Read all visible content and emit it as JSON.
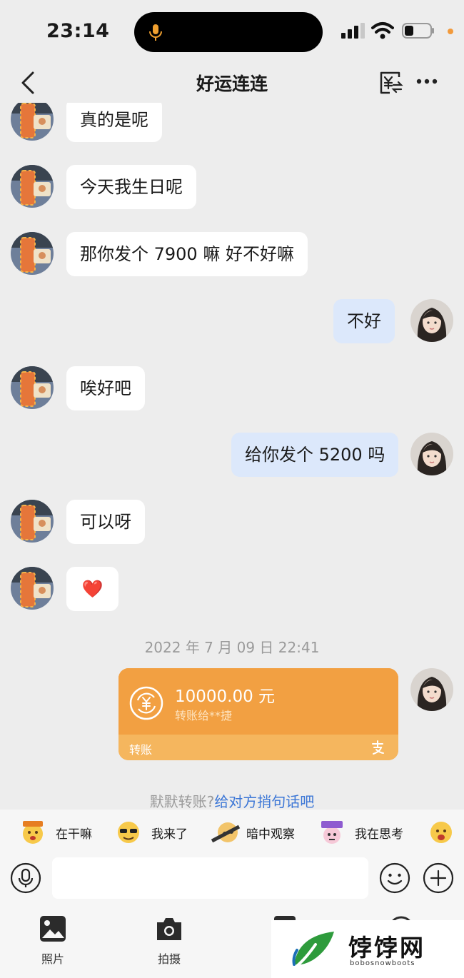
{
  "status_bar": {
    "time": "23:14"
  },
  "nav": {
    "title": "好运连连"
  },
  "messages": [
    {
      "side": "left",
      "text": "真的是呢"
    },
    {
      "side": "left",
      "text": "今天我生日呢"
    },
    {
      "side": "left",
      "text": "那你发个 7900 嘛 好不好嘛"
    },
    {
      "side": "right",
      "text": "不好"
    },
    {
      "side": "left",
      "text": "唉好吧"
    },
    {
      "side": "right",
      "text": "给你发个 5200 吗"
    },
    {
      "side": "left",
      "text": "可以呀"
    },
    {
      "side": "left",
      "text": "❤️"
    }
  ],
  "timestamp": "2022 年 7 月 09 日 22:41",
  "transfer": {
    "amount": "10000.00 元",
    "recipient": "转账给**捷",
    "label": "转账",
    "icon": "yuan-transfer-icon"
  },
  "hint": {
    "prefix": "默默转账?",
    "link": "给对方捎句话吧"
  },
  "stickers": [
    {
      "label": "在干嘛",
      "icon": "sticker-what-doing"
    },
    {
      "label": "我来了",
      "icon": "sticker-sunglasses"
    },
    {
      "label": "暗中观察",
      "icon": "sticker-observe"
    },
    {
      "label": "我在思考",
      "icon": "sticker-thinking"
    }
  ],
  "input": {
    "placeholder": ""
  },
  "toolbar": {
    "photo_label": "照片",
    "camera_label": "拍摄"
  },
  "watermark": {
    "text": "饽饽网",
    "subtext": "bobosnowboots"
  },
  "colors": {
    "accent_orange": "#f2a042",
    "right_bubble": "#dce8fb",
    "link_blue": "#3b76d6"
  }
}
